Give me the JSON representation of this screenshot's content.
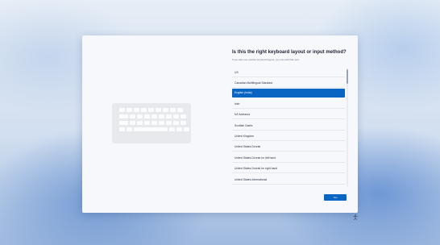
{
  "dialog": {
    "title": "Is this the right keyboard layout or input method?",
    "subtitle": "If you also use another keyboard layout, you can add that next.",
    "illustration_icon": "keyboard-icon"
  },
  "layouts": [
    {
      "label": "US",
      "selected": false
    },
    {
      "label": "Canadian Multilingual Standard",
      "selected": false
    },
    {
      "label": "English (India)",
      "selected": true
    },
    {
      "label": "Irish",
      "selected": false
    },
    {
      "label": "NZ Aotearoa",
      "selected": false
    },
    {
      "label": "Scottish Gaelic",
      "selected": false
    },
    {
      "label": "United Kingdom",
      "selected": false
    },
    {
      "label": "United States-Dvorak",
      "selected": false
    },
    {
      "label": "United States-Dvorak for left hand",
      "selected": false
    },
    {
      "label": "United States-Dvorak for right hand",
      "selected": false
    },
    {
      "label": "United States-International",
      "selected": false
    }
  ],
  "buttons": {
    "yes_label": "Yes"
  },
  "taskbar": {
    "accessibility_icon": "accessibility-icon"
  },
  "colors": {
    "accent": "#0a64c2",
    "dialog_bg": "#f6f8fc"
  }
}
